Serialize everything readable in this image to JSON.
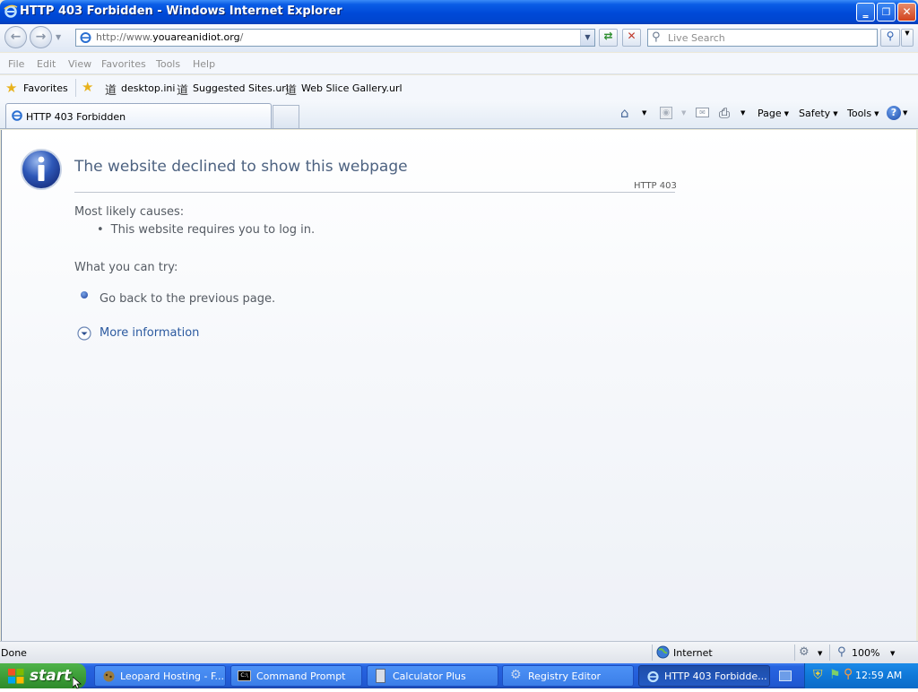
{
  "window": {
    "title": "HTTP 403 Forbidden - Windows Internet Explorer",
    "controls": {
      "minimize": "‗",
      "maximize": "❐",
      "close": "✕"
    }
  },
  "addressbar": {
    "url_prefix": "http://www.",
    "url_domain": "youareanidiot.org",
    "url_suffix": "/",
    "search_placeholder": "Live Search"
  },
  "menu": [
    "File",
    "Edit",
    "View",
    "Favorites",
    "Tools",
    "Help"
  ],
  "favorites_bar": {
    "favorites_label": "Favorites",
    "links": [
      "desktop.ini",
      "Suggested Sites.url",
      "Web Slice Gallery.url"
    ]
  },
  "tabs": {
    "active_tab": "HTTP 403 Forbidden"
  },
  "command_bar": {
    "page": "Page",
    "safety": "Safety",
    "tools": "Tools"
  },
  "content": {
    "heading": "The website declined to show this webpage",
    "code": "HTTP 403",
    "causes_header": "Most likely causes:",
    "causes": [
      "This website requires you to log in."
    ],
    "try_header": "What you can try:",
    "go_back": "Go back to the previous page.",
    "more_info": "More information"
  },
  "statusbar": {
    "status": "Done",
    "zone": "Internet",
    "zoom": "100%"
  },
  "taskbar": {
    "start": "start",
    "tasks": [
      "Leopard Hosting - F...",
      "Command Prompt",
      "Calculator Plus",
      "Registry Editor",
      "HTTP 403 Forbidde..."
    ],
    "clock": "12:59 AM"
  },
  "colors": {
    "titlebar": "#0049d8",
    "heading": "#4d6280",
    "link": "#2c5aa0",
    "start_button": "#3a9a35",
    "taskbar": "#245edb"
  }
}
